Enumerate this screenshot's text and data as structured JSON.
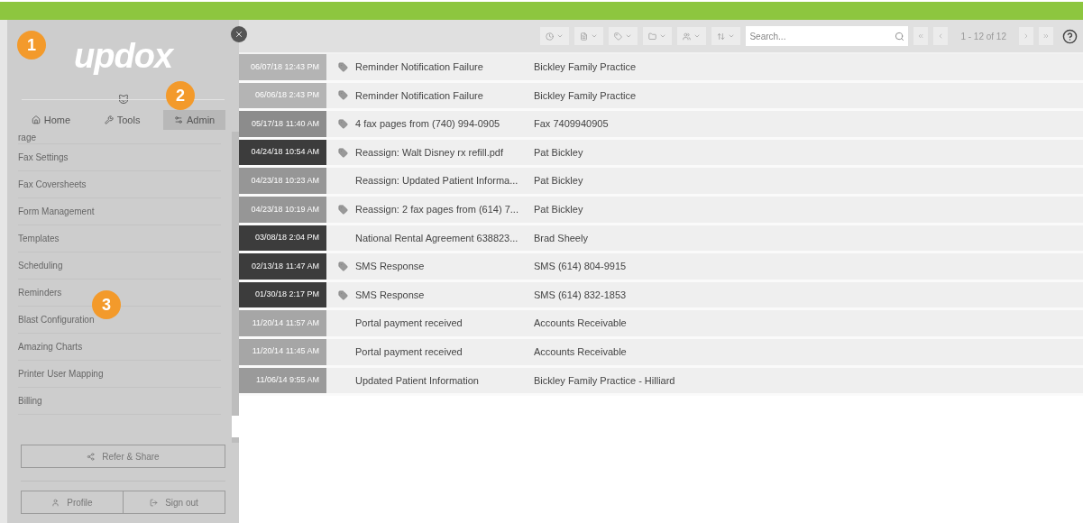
{
  "sidebar": {
    "logo": "updox",
    "callouts": [
      "1",
      "2",
      "3"
    ],
    "tabs": [
      {
        "label": "Home",
        "selected": false
      },
      {
        "label": "Tools",
        "selected": false
      },
      {
        "label": "Admin",
        "selected": true
      }
    ],
    "menu": [
      "rage",
      "Fax Settings",
      "Fax Coversheets",
      "Form Management",
      "Templates",
      "Scheduling",
      "Reminders",
      "Blast Configuration",
      "Amazing Charts",
      "Printer User Mapping",
      "Billing"
    ],
    "refer_button": "Refer & Share",
    "profile_button": "Profile",
    "signout_button": "Sign out"
  },
  "toolbar": {
    "search": {
      "placeholder": "Search..."
    },
    "pagination": "1 - 12 of 12"
  },
  "rows": [
    {
      "date": "06/07/18 12:43 PM",
      "color": "#b4b4b4",
      "tagged": true,
      "subject": "Reminder Notification Failure",
      "sender": "Bickley Family Practice"
    },
    {
      "date": "06/06/18 2:43 PM",
      "color": "#b4b4b4",
      "tagged": true,
      "subject": "Reminder Notification Failure",
      "sender": "Bickley Family Practice"
    },
    {
      "date": "05/17/18 11:40 AM",
      "color": "#8c8c8c",
      "tagged": true,
      "subject": "4 fax pages from (740) 994-0905",
      "sender": "Fax 7409940905"
    },
    {
      "date": "04/24/18 10:54 AM",
      "color": "#3c3c3c",
      "tagged": true,
      "subject": "Reassign: Walt Disney rx refill.pdf",
      "sender": "Pat Bickley"
    },
    {
      "date": "04/23/18 10:23 AM",
      "color": "#969696",
      "tagged": false,
      "subject": "Reassign: Updated Patient Informa...",
      "sender": "Pat Bickley"
    },
    {
      "date": "04/23/18 10:19 AM",
      "color": "#969696",
      "tagged": true,
      "subject": "Reassign: 2 fax pages from (614) 7...",
      "sender": "Pat Bickley"
    },
    {
      "date": "03/08/18 2:04 PM",
      "color": "#3c3c3c",
      "tagged": false,
      "subject": "National Rental Agreement 638823...",
      "sender": "Brad Sheely"
    },
    {
      "date": "02/13/18 11:47 AM",
      "color": "#3c3c3c",
      "tagged": true,
      "subject": "SMS Response",
      "sender": "SMS (614) 804-9915"
    },
    {
      "date": "01/30/18 2:17 PM",
      "color": "#3c3c3c",
      "tagged": true,
      "subject": "SMS Response",
      "sender": "SMS (614) 832-1853"
    },
    {
      "date": "11/20/14 11:57 AM",
      "color": "#a6a6a6",
      "tagged": false,
      "subject": "Portal payment received",
      "sender": "Accounts Receivable"
    },
    {
      "date": "11/20/14 11:45 AM",
      "color": "#a6a6a6",
      "tagged": false,
      "subject": "Portal payment received",
      "sender": "Accounts Receivable"
    },
    {
      "date": "11/06/14 9:55 AM",
      "color": "#9a9a9a",
      "tagged": false,
      "subject": "Updated Patient Information",
      "sender": "Bickley Family Practice - Hilliard"
    }
  ]
}
